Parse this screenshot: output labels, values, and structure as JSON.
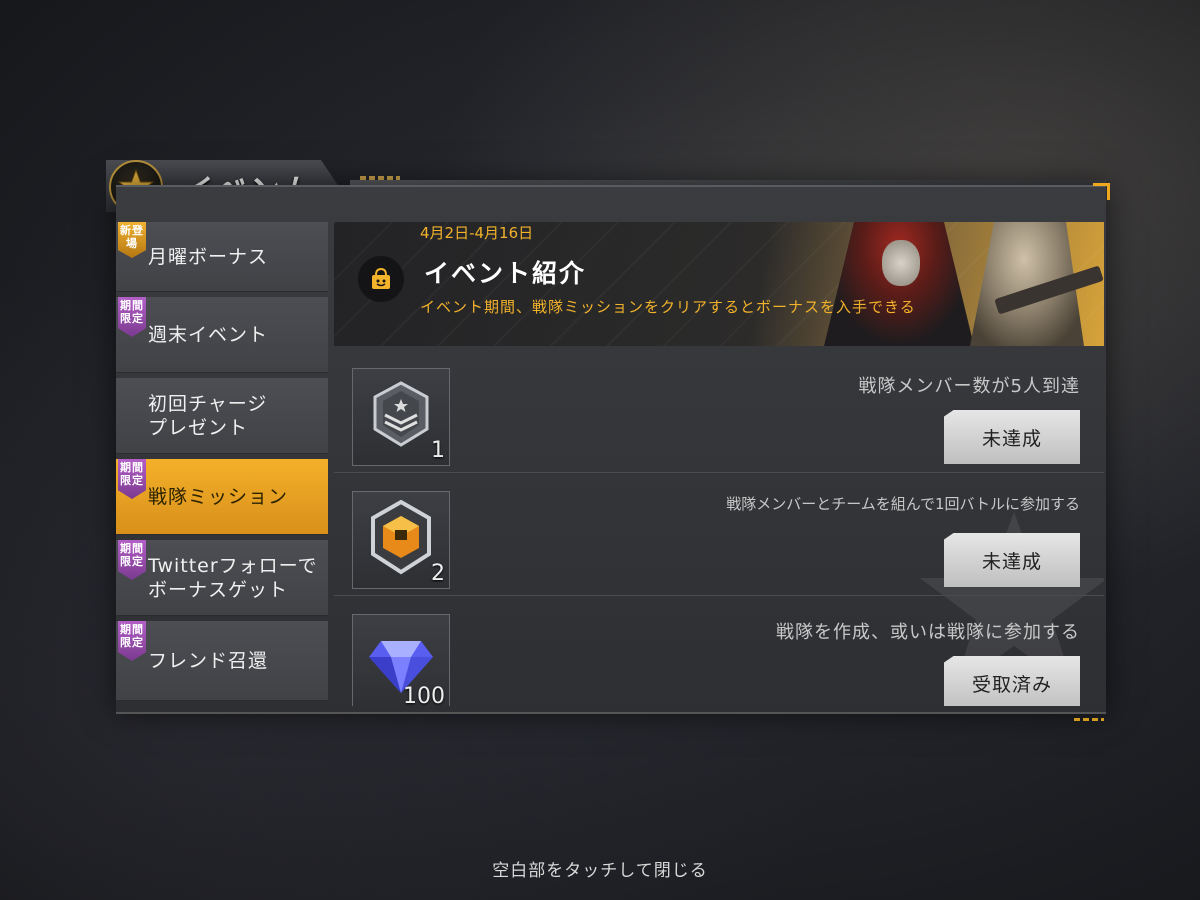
{
  "header": {
    "title": "イベント"
  },
  "sidebar": {
    "items": [
      {
        "label": "月曜ボーナス",
        "badge": "新登場",
        "badge_color": "#f0b030",
        "active": false
      },
      {
        "label": "週末イベント",
        "badge": "期間限定",
        "badge_color": "#9b4db3",
        "active": false
      },
      {
        "label": "初回チャージ\nプレゼント",
        "badge": "",
        "active": false
      },
      {
        "label": "戦隊ミッション",
        "badge": "期間限定",
        "badge_color": "#9b4db3",
        "active": true
      },
      {
        "label": "Twitterフォローで\nボーナスゲット",
        "badge": "期間限定",
        "badge_color": "#9b4db3",
        "active": false
      },
      {
        "label": "フレンド召還",
        "badge": "期間限定",
        "badge_color": "#9b4db3",
        "active": false
      }
    ]
  },
  "banner": {
    "date": "4月2日-4月16日",
    "title": "イベント紹介",
    "description": "イベント期間、戦隊ミッションをクリアするとボーナスを入手できる"
  },
  "missions": [
    {
      "description": "戦隊メンバー数が5人到達",
      "reward_icon": "rank-chevron-icon",
      "reward_count": "1",
      "button": "未達成"
    },
    {
      "description": "戦隊メンバーとチームを組んで1回バトルに参加する",
      "reward_icon": "treasure-crate-icon",
      "reward_count": "2",
      "button": "未達成"
    },
    {
      "description": "戦隊を作成、或いは戦隊に参加する",
      "reward_icon": "diamond-icon",
      "reward_count": "100",
      "button": "受取済み"
    }
  ],
  "footer": {
    "close_hint": "空白部をタッチして閉じる"
  },
  "colors": {
    "accent": "#f2b22a",
    "active_tab": "#e8a020",
    "badge_purple": "#9b4db3"
  }
}
